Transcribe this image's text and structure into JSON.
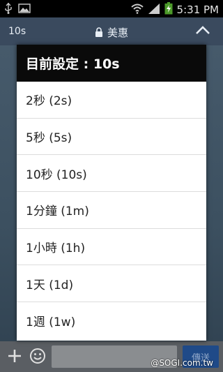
{
  "status_bar": {
    "time": "5:31 PM",
    "icons": [
      "usb-icon",
      "image-icon",
      "wifi-icon",
      "signal-icon",
      "battery-charging-icon"
    ]
  },
  "chat_header": {
    "timer_label": "10s",
    "title": "美惠",
    "icons": [
      "lock-icon",
      "chevron-up-icon"
    ]
  },
  "dialog": {
    "title": "目前設定 : 10s",
    "options": [
      {
        "label": "2秒 (2s)"
      },
      {
        "label": "5秒 (5s)"
      },
      {
        "label": "10秒 (10s)"
      },
      {
        "label": "1分鐘 (1m)"
      },
      {
        "label": "1小時 (1h)"
      },
      {
        "label": "1天 (1d)"
      },
      {
        "label": "1週 (1w)"
      }
    ]
  },
  "input_bar": {
    "send_label": "傳送",
    "icons": [
      "plus-icon",
      "emoji-icon"
    ]
  },
  "watermark": "@SOGI.com.tw",
  "colors": {
    "status_bar": "#000000",
    "header": "#3a4a5e",
    "dialog_title_bg": "#0a0a0a",
    "dialog_bg": "#ffffff",
    "send_button": "#1f4a88"
  }
}
